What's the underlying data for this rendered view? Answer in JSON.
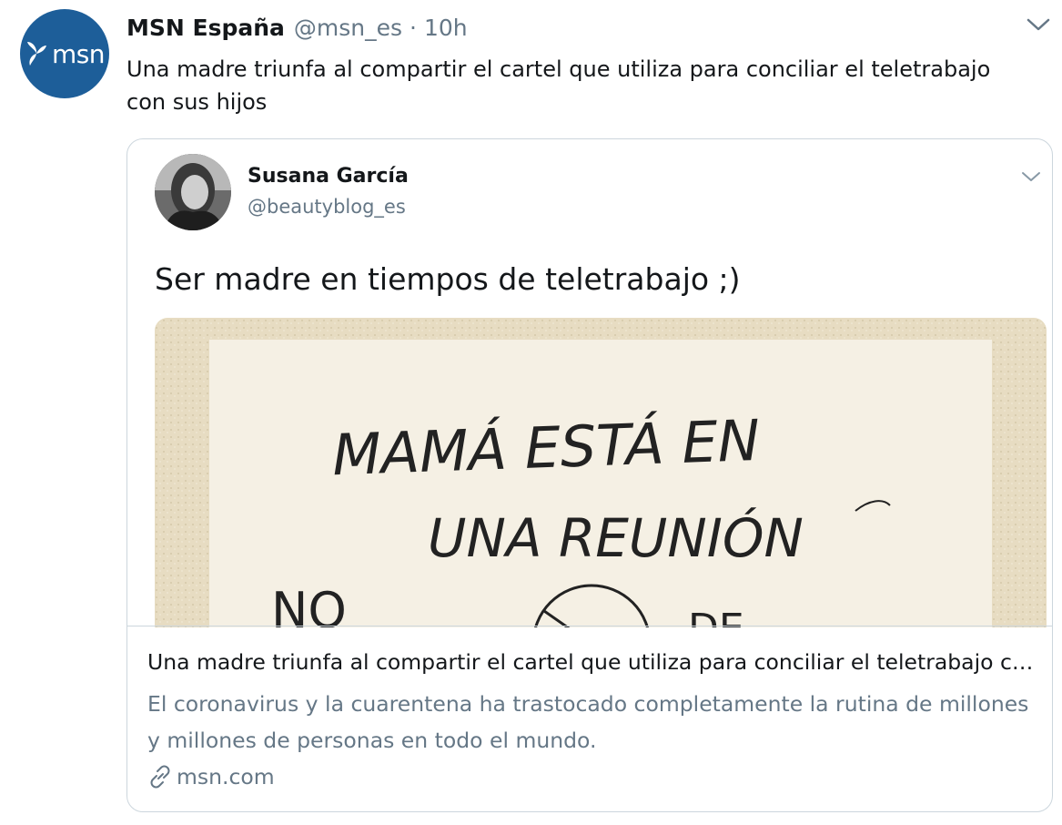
{
  "tweet": {
    "avatar_text": "msn",
    "author_name": "MSN España",
    "author_handle": "@msn_es",
    "separator": "·",
    "time": "10h",
    "text": "Una madre triunfa al compartir el cartel que utiliza para conciliar el teletrabajo con sus hijos",
    "menu_icon": "chevron-down-icon"
  },
  "card": {
    "embedded": {
      "author_name": "Susana García",
      "author_handle": "@beautyblog_es",
      "text": "Ser madre en tiempos de teletrabajo ;)",
      "menu_icon": "chevron-down-icon",
      "photo_text_line1": "MAMÁ ESTÁ EN",
      "photo_text_line2": "UNA REUNIÓN",
      "photo_text_no": "NO",
      "photo_text_de": "DE"
    },
    "title": "Una madre triunfa al compartir el cartel que utiliza para conciliar el teletrabajo con sus hijos",
    "description": "El coronavirus y la cuarentena ha trastocado completamente la rutina de millones y millones de personas en todo el mundo.",
    "link_icon": "link-icon",
    "domain": "msn.com"
  }
}
